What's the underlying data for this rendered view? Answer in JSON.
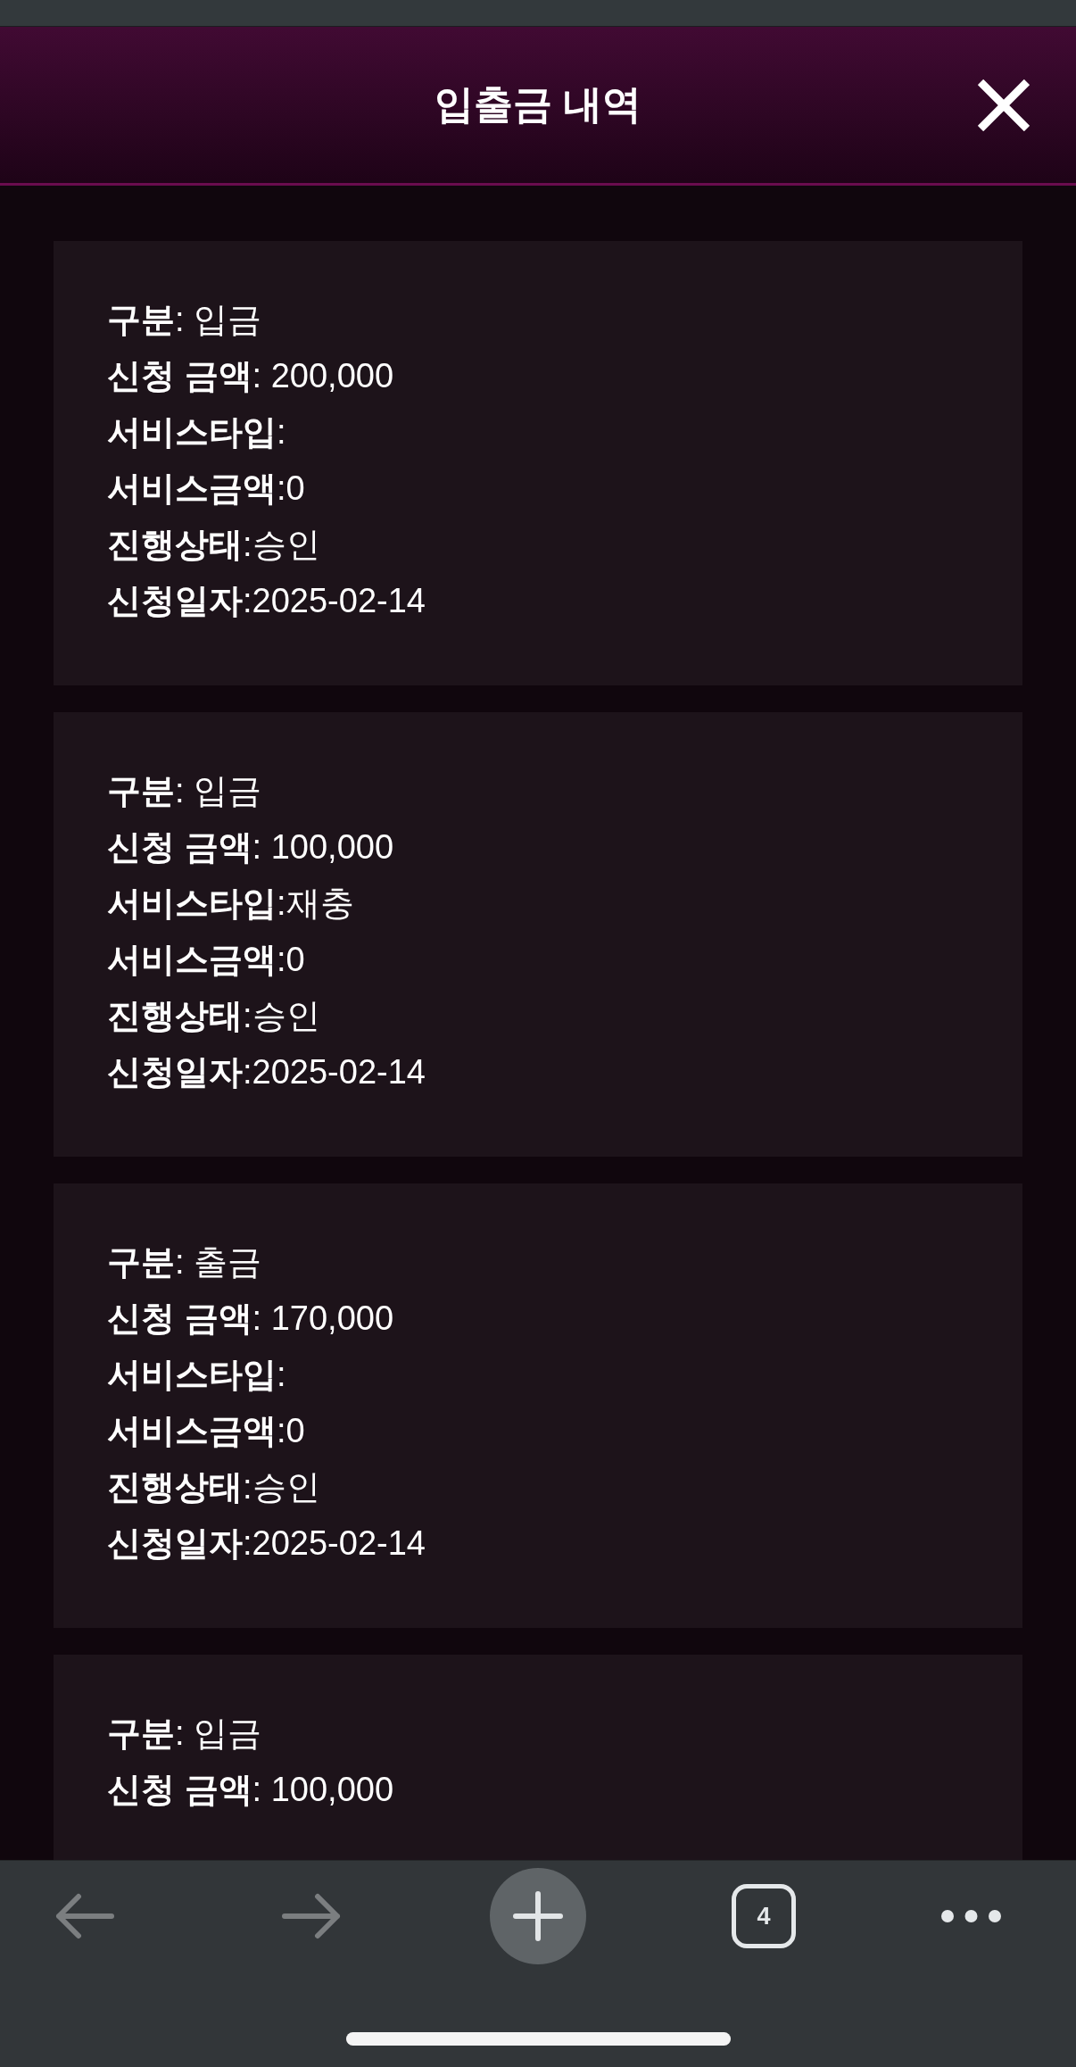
{
  "header": {
    "title": "입출금 내역"
  },
  "transactions": [
    {
      "lines": [
        "**구분**: 입금",
        "**신청 금액**: 200,000",
        "**서비스타입**:",
        "**서비스금액**:0",
        "**진행상태**:승인",
        "**신청일자**:2025-02-14"
      ]
    },
    {
      "lines": [
        "**구분**: 입금",
        "**신청 금액**: 100,000",
        "**서비스타입**:재충",
        "**서비스금액**:0",
        "**진행상태**:승인",
        "**신청일자**:2025-02-14"
      ]
    },
    {
      "lines": [
        "**구분**: 출금",
        "**신청 금액**: 170,000",
        "**서비스타입**:",
        "**서비스금액**:0",
        "**진행상태**:승인",
        "**신청일자**:2025-02-14"
      ]
    },
    {
      "lines": [
        "**구분**: 입금",
        "**신청 금액**: 100,000"
      ]
    }
  ],
  "toolbar": {
    "back": {
      "disabled": true
    },
    "forward": {
      "disabled": true
    },
    "tab_count": "4"
  }
}
